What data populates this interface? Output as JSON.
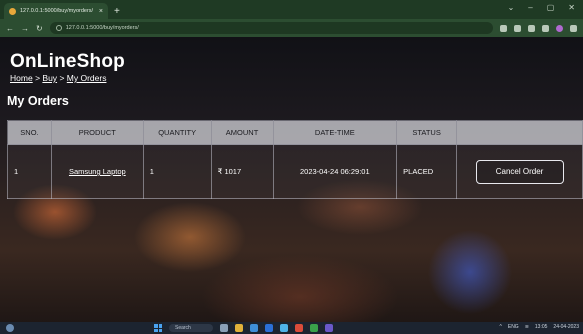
{
  "browser": {
    "tab_title": "127.0.0.1:5000/buy/myorders/",
    "tab_close": "×",
    "new_tab": "+",
    "url": "127.0.0.1:5000/buy/myorders/",
    "window_controls": [
      "⌄",
      "–",
      "▢",
      "✕"
    ]
  },
  "site": {
    "brand": "OnLineShop",
    "breadcrumb": [
      {
        "label": "Home"
      },
      {
        "label": "Buy"
      },
      {
        "label": "My Orders"
      }
    ],
    "breadcrumb_sep": ">",
    "heading": "My Orders"
  },
  "orders_table": {
    "headers": [
      "SNO.",
      "PRODUCT",
      "QUANTITY",
      "AMOUNT",
      "DATE-TIME",
      "STATUS",
      ""
    ],
    "rows": [
      {
        "sno": "1",
        "product": "Samsung Laptop",
        "quantity": "1",
        "amount": "₹ 1017",
        "datetime": "2023-04-24 06:29:01",
        "status": "PLACED",
        "action": "Cancel Order"
      }
    ]
  },
  "taskbar": {
    "search_label": "Search",
    "lang": "ENG",
    "time": "13:05",
    "date": "24-04-2023"
  },
  "colors": {
    "tab_bar": "#1f3a24",
    "toolbar": "#2c4d31",
    "table_header": "#cdcdd4",
    "taskbar": "#1c2430"
  }
}
